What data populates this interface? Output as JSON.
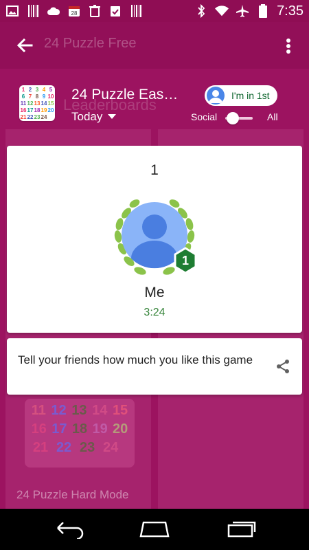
{
  "status_bar": {
    "time": "7:35",
    "icons_left": [
      "image-icon",
      "barcode-icon",
      "cloud-icon",
      "calendar-icon",
      "trash-icon",
      "clipboard-check-icon",
      "barcode-icon"
    ],
    "icons_right": [
      "bluetooth-icon",
      "wifi-icon",
      "airplane-icon",
      "battery-icon"
    ],
    "calendar_day": "28"
  },
  "app_bar": {
    "title": "24 Puzzle Free"
  },
  "header": {
    "game_title": "24 Puzzle Eas…",
    "leaderboards_ghost": "Leaderboards",
    "timeframe": "Today",
    "chip_label": "I'm in 1st",
    "social_label": "Social",
    "all_label": "All"
  },
  "game_icon_grid": [
    [
      "1",
      "2",
      "3",
      "4",
      "5"
    ],
    [
      "6",
      "7",
      "8",
      "9",
      "10"
    ],
    [
      "11",
      "12",
      "13",
      "14",
      "15"
    ],
    [
      "16",
      "17",
      "18",
      "19",
      "20"
    ],
    [
      "21",
      "22",
      "23",
      "24",
      ""
    ]
  ],
  "leaderboard": {
    "rank": "1",
    "badge_rank": "1",
    "player_name": "Me",
    "score": "3:24"
  },
  "share": {
    "text": "Tell your friends how much you like this game"
  },
  "background": {
    "grid_rows": [
      [
        "11",
        "12",
        "13",
        "14",
        "15"
      ],
      [
        "16",
        "17",
        "18",
        "19",
        "20"
      ],
      [
        "21",
        "22",
        "23",
        "24",
        ""
      ]
    ],
    "hard_mode_label": "24 Puzzle Hard Mode"
  },
  "colors": {
    "app_bar": "#920f58",
    "background": "#9c1360",
    "accent_green": "#37853b",
    "badge_green": "#1e7d32",
    "chip_text": "#0d652d"
  }
}
